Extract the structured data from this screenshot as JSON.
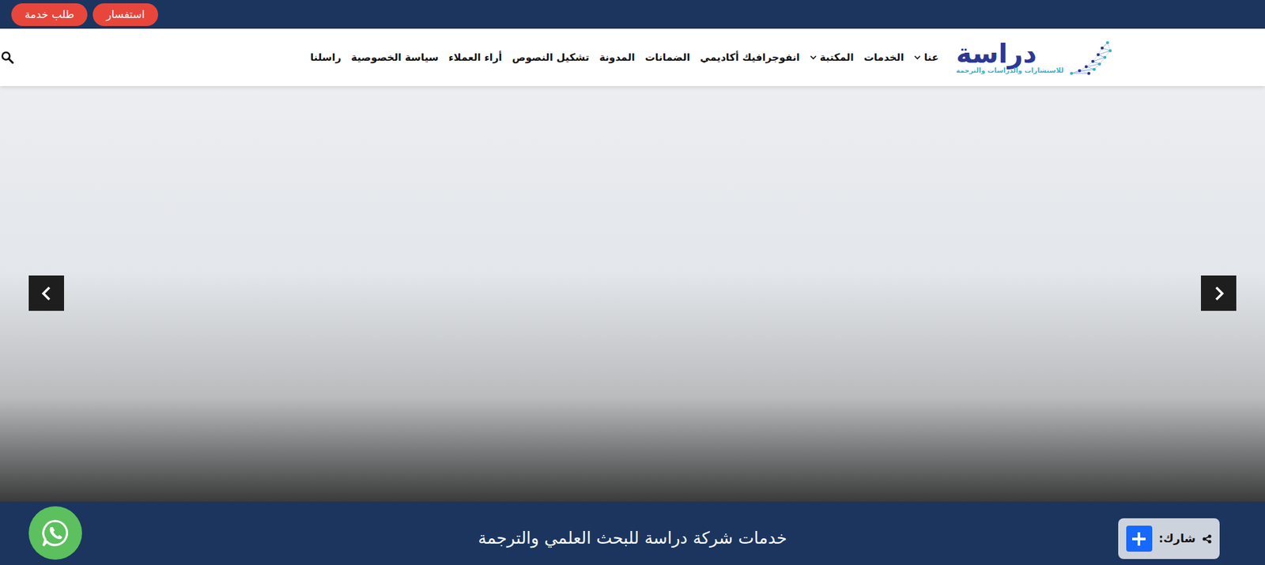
{
  "top_bar": {
    "buttons": [
      {
        "label": "استفسار"
      },
      {
        "label": "طلب خدمة"
      }
    ]
  },
  "logo": {
    "title": "دراسة",
    "subtitle": "للاستشارات والدراسات والترجمة"
  },
  "nav": {
    "items": [
      {
        "label": "عنا",
        "dropdown": true
      },
      {
        "label": "الخدمات",
        "dropdown": false
      },
      {
        "label": "المكتبة",
        "dropdown": true
      },
      {
        "label": "انفوجرافيك أكاديمي",
        "dropdown": false
      },
      {
        "label": "الضمانات",
        "dropdown": false
      },
      {
        "label": "المدونة",
        "dropdown": false
      },
      {
        "label": "تشكيل النصوص",
        "dropdown": false
      },
      {
        "label": "أراء العملاء",
        "dropdown": false
      },
      {
        "label": "سياسة الخصوصية",
        "dropdown": false
      },
      {
        "label": "راسلنا",
        "dropdown": false
      }
    ]
  },
  "section_bar": {
    "title": "خدمات شركة دراسة للبحث العلمي والترجمة",
    "share_label": "شارك:"
  }
}
